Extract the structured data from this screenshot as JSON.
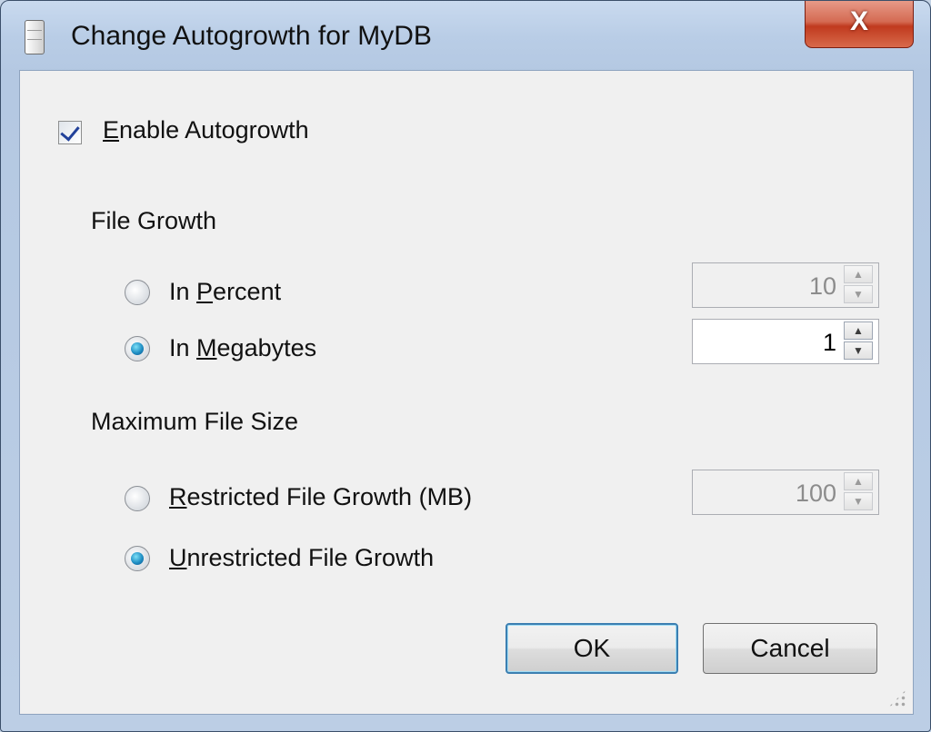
{
  "window": {
    "title": "Change Autogrowth for MyDB",
    "close_glyph": "X"
  },
  "enable_autogrowth": {
    "label_access": "E",
    "label_rest": "nable Autogrowth",
    "checked": true
  },
  "file_growth": {
    "heading": "File Growth",
    "percent": {
      "prefix": "In ",
      "access": "P",
      "rest": "ercent",
      "selected": false,
      "value": "10",
      "enabled": false
    },
    "megabytes": {
      "prefix": "In ",
      "access": "M",
      "rest": "egabytes",
      "selected": true,
      "value": "1",
      "enabled": true
    }
  },
  "max_file_size": {
    "heading": "Maximum File Size",
    "restricted": {
      "access": "R",
      "rest": "estricted File Growth (MB)",
      "selected": false,
      "value": "100",
      "enabled": false
    },
    "unrestricted": {
      "access": "U",
      "rest": "nrestricted File Growth",
      "selected": true
    }
  },
  "buttons": {
    "ok": "OK",
    "cancel": "Cancel"
  },
  "icons": {
    "window_icon": "database-file-icon",
    "close": "close-icon",
    "spin_up": "▲",
    "spin_down": "▼"
  }
}
